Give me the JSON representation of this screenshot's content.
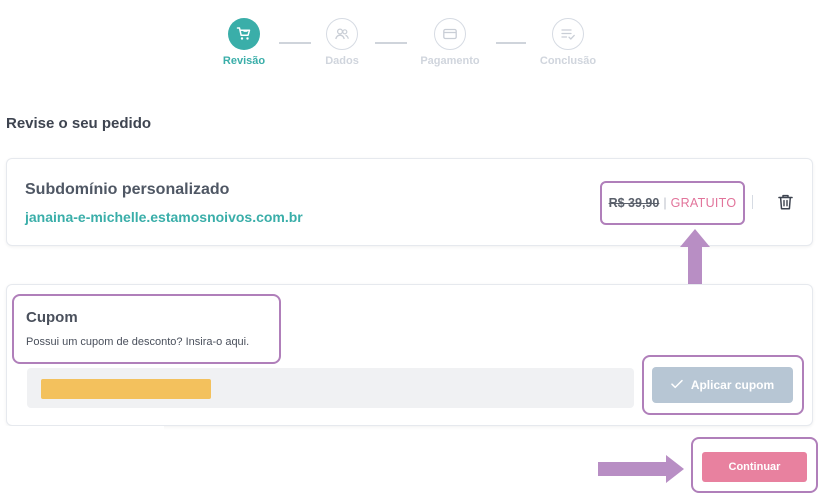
{
  "stepper": {
    "steps": [
      {
        "label": "Revisão",
        "icon": "cart-icon",
        "state": "active"
      },
      {
        "label": "Dados",
        "icon": "users-icon",
        "state": "inactive"
      },
      {
        "label": "Pagamento",
        "icon": "credit-card-icon",
        "state": "inactive"
      },
      {
        "label": "Conclusão",
        "icon": "checklist-icon",
        "state": "inactive"
      }
    ]
  },
  "review": {
    "title": "Revise o seu pedido"
  },
  "item": {
    "title": "Subdomínio personalizado",
    "subdomain": "janaina-e-michelle.estamosnoivos.com.br",
    "price_old": "R$ 39,90",
    "price_separator": "|",
    "price_new": "GRATUITO",
    "delete_icon": "trash-icon"
  },
  "coupon": {
    "title": "Cupom",
    "description": "Possui um cupom de desconto? Insira-o aqui.",
    "input_value": "",
    "apply_label": "Aplicar cupom"
  },
  "footer": {
    "continue_label": "Continuar"
  },
  "colors": {
    "teal": "#3aaea9",
    "pink": "#e8819f",
    "highlight_purple": "#b07fba",
    "disabled_blue": "#b7c6d4",
    "marker_yellow": "#f3c15d"
  }
}
